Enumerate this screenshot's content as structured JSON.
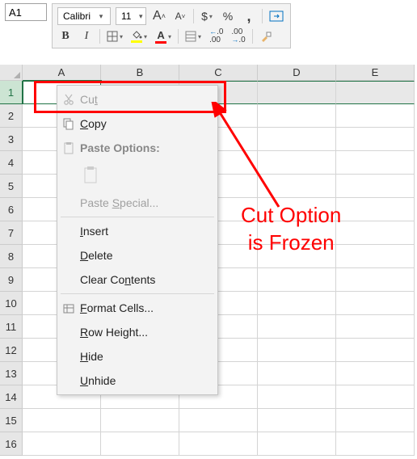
{
  "nameBox": "A1",
  "font": {
    "name": "Calibri",
    "size": "11"
  },
  "toolbar": {
    "increaseFont": "A",
    "decreaseFont": "A",
    "currency": "$",
    "percent": "%",
    "comma": ",",
    "bold": "B",
    "italic": "I",
    "fontColorLetter": "A",
    "decimalIncrease": ".0\n.00",
    "decimalDecrease": ".00\n.0"
  },
  "columns": [
    "A",
    "B",
    "C",
    "D",
    "E"
  ],
  "rows": [
    "1",
    "2",
    "3",
    "4",
    "5",
    "6",
    "7",
    "8",
    "9",
    "10",
    "11",
    "12",
    "13",
    "14",
    "15",
    "16"
  ],
  "contextMenu": {
    "cut": "Cut",
    "copy": "Copy",
    "pasteOptions": "Paste Options:",
    "pasteSpecial": "Paste Special...",
    "insert": "Insert",
    "delete": "Delete",
    "clearContents": "Clear Contents",
    "formatCells": "Format Cells...",
    "rowHeight": "Row Height...",
    "hide": "Hide",
    "unhide": "Unhide"
  },
  "callout": {
    "line1": "Cut Option",
    "line2": "is Frozen"
  },
  "icons": {
    "scissors": "✂",
    "copy": "⧉",
    "clipboard": "📋",
    "borders": "⊞",
    "bucket": "🪣",
    "format": "⠿",
    "merge": "⇥",
    "brush": "🖌",
    "table": "▦"
  }
}
